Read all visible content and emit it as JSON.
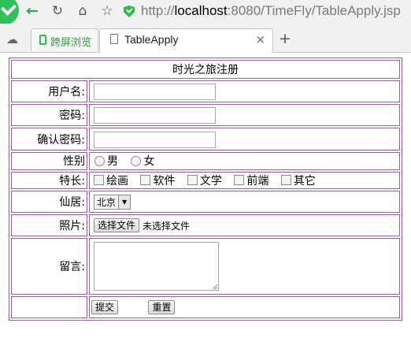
{
  "browser": {
    "url_scheme": "http://",
    "url_host": "localhost",
    "url_rest": ":8080/TimeFly/TableApply.jsp",
    "pinned_tab_label": "跨屏浏览",
    "active_tab_title": "TableApply",
    "close_glyph": "×",
    "new_tab_glyph": "+"
  },
  "form": {
    "title": "时光之旅注册",
    "username_label": "用户名:",
    "password_label": "密码:",
    "confirm_label": "确认密码:",
    "gender_label": "性别",
    "gender_options": [
      "男",
      "女"
    ],
    "skills_label": "特长:",
    "skills": [
      "绘画",
      "软件",
      "文学",
      "前端",
      "其它"
    ],
    "residence_label": "仙居:",
    "residence_value": "北京",
    "photo_label": "照片:",
    "file_button": "选择文件",
    "file_status": "未选择文件",
    "message_label": "留言:",
    "submit": "提交",
    "reset": "重置"
  }
}
